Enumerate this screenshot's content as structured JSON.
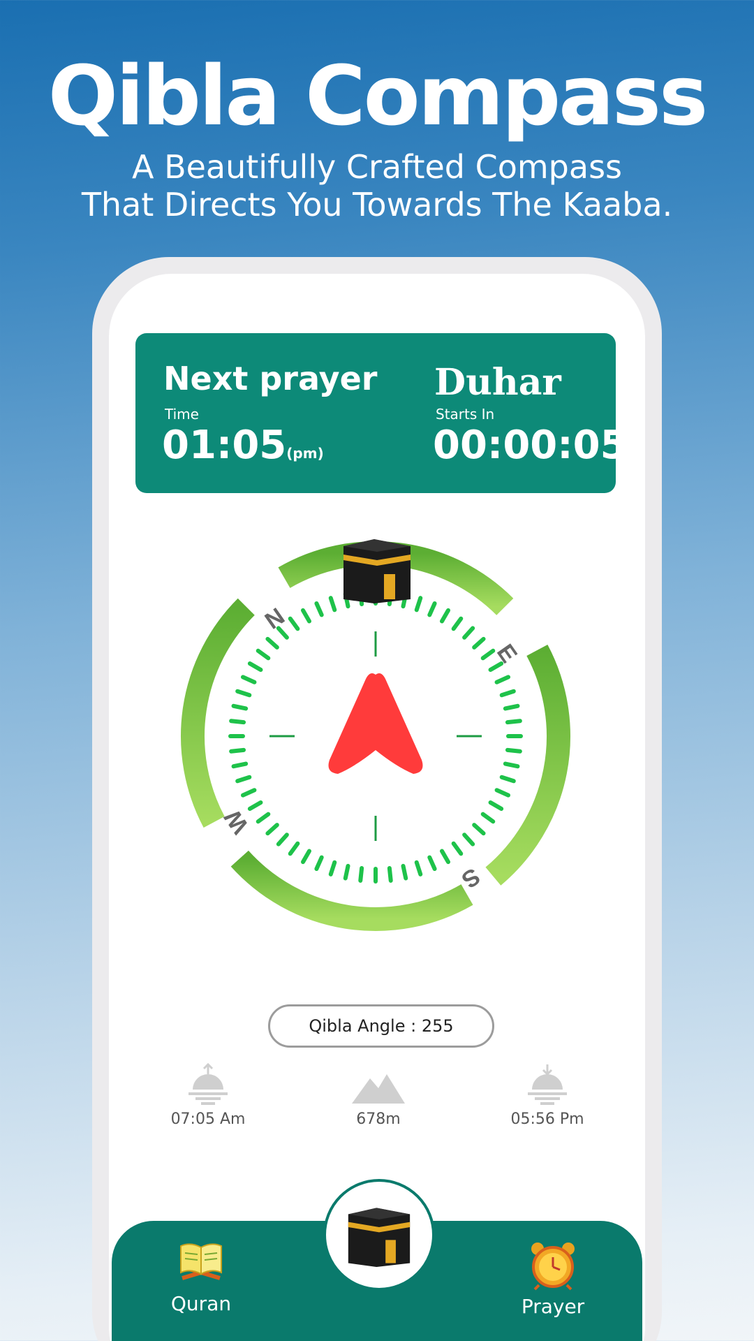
{
  "hero": {
    "title": "Qibla Compass",
    "subtitle_line1": "A Beautifully Crafted Compass",
    "subtitle_line2": "That Directs You Towards The Kaaba."
  },
  "prayer_card": {
    "heading": "Next prayer",
    "time_label": "Time",
    "time": "01:05",
    "time_suffix": "(pm)",
    "prayer_name": "Duhar",
    "starts_label": "Starts In",
    "countdown": "00:00:05"
  },
  "compass": {
    "north": "N",
    "east": "E",
    "south": "S",
    "west": "W",
    "ring_color": "#76c043",
    "tick_color": "#1ec24a",
    "needle_color": "#ff3b3b"
  },
  "qibla": {
    "angle_text": "Qibla Angle : 255"
  },
  "stats": {
    "sunrise": "07:05 Am",
    "altitude": "678m",
    "sunset": "05:56 Pm"
  },
  "nav": {
    "quran_label": "Quran",
    "prayer_label": "Prayer",
    "quran_icon": "book-icon",
    "prayer_icon": "alarm-clock-icon",
    "center_icon": "kaaba-icon"
  },
  "colors": {
    "card_bg": "#0d8a78",
    "nav_bg": "#0a7a6c"
  }
}
